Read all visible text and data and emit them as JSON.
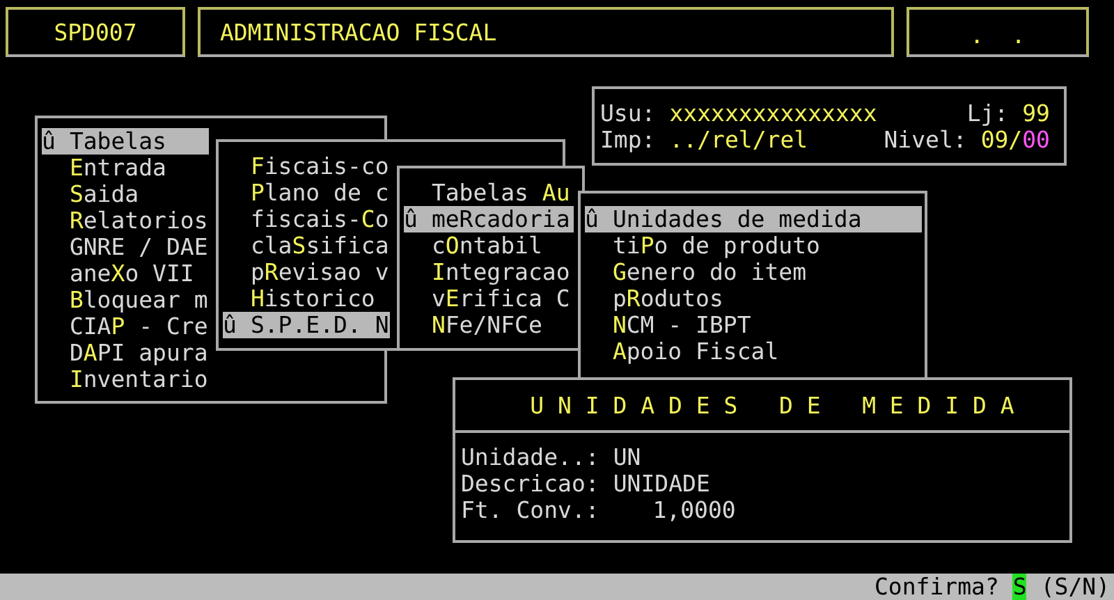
{
  "header": {
    "program_code": "SPD007",
    "title": "ADMINISTRACAO FISCAL",
    "right_text": ".  ."
  },
  "info": {
    "rows": [
      {
        "fields": [
          {
            "label": "Usu:",
            "value": "xxxxxxxxxxxxxxx"
          },
          {
            "label": "Lj:",
            "value": "99"
          }
        ]
      },
      {
        "fields": [
          {
            "label": "Imp:",
            "value": "../rel/rel"
          },
          {
            "label": "Nivel:",
            "value": "09/",
            "suffix": "00"
          }
        ]
      }
    ]
  },
  "menus": [
    {
      "items": [
        {
          "marker": "û",
          "before": "Tabelas",
          "selected": true
        },
        {
          "key": "E",
          "after": "ntrada",
          "selected": false
        },
        {
          "key": "S",
          "after": "aida",
          "selected": false
        },
        {
          "key": "R",
          "after": "elatorios",
          "selected": false
        },
        {
          "before": "GNRE / DAE",
          "selected": false
        },
        {
          "before": "ane",
          "key": "X",
          "after": "o VII",
          "selected": false
        },
        {
          "key": "B",
          "after": "loquear m",
          "selected": false
        },
        {
          "before": "CIA",
          "key": "P",
          "after": " - Cre",
          "selected": false
        },
        {
          "before": "D",
          "key": "A",
          "after": "PI apura",
          "selected": false
        },
        {
          "key": "I",
          "after": "nventario",
          "selected": false
        }
      ]
    },
    {
      "items": [
        {
          "key": "F",
          "after": "iscais-co",
          "selected": false
        },
        {
          "key": "P",
          "after": "lano de c",
          "selected": false
        },
        {
          "before": "fiscais-",
          "key": "C",
          "after": "o",
          "selected": false
        },
        {
          "before": "cla",
          "key": "S",
          "after": "sifica",
          "selected": false
        },
        {
          "before": "p",
          "key": "R",
          "after": "evisao v",
          "selected": false
        },
        {
          "key": "H",
          "after": "istorico",
          "selected": false
        },
        {
          "marker": "û",
          "before": "S.P.E.D. N",
          "selected": true
        }
      ]
    },
    {
      "items": [
        {
          "before": "Tabelas ",
          "key": "Au",
          "selected": false
        },
        {
          "marker": "û",
          "before": "meRcadoria",
          "selected": true
        },
        {
          "before": "c",
          "key": "O",
          "after": "ntabil",
          "selected": false
        },
        {
          "key": "I",
          "after": "ntegracao",
          "selected": false
        },
        {
          "before": "v",
          "key": "E",
          "after": "rifica C",
          "selected": false
        },
        {
          "key": "N",
          "after": "Fe/NFCe",
          "selected": false
        }
      ]
    },
    {
      "items": [
        {
          "marker": "û",
          "before": "Unidades de medida",
          "selected": true
        },
        {
          "before": "ti",
          "key": "P",
          "after": "o de produto",
          "selected": false
        },
        {
          "key": "G",
          "after": "enero do item",
          "selected": false
        },
        {
          "before": "p",
          "key": "R",
          "after": "odutos",
          "selected": false
        },
        {
          "key": "N",
          "after": "CM - IBPT",
          "selected": false
        },
        {
          "key": "A",
          "after": "poio Fiscal",
          "selected": false
        }
      ]
    }
  ],
  "detail": {
    "title": "U N I D A D E S   D E   M E D I D A",
    "fields": [
      {
        "label": "Unidade..:",
        "value": "UN",
        "kind": "text"
      },
      {
        "label": "Descricao:",
        "value": "UNIDADE",
        "kind": "text"
      },
      {
        "label": "Ft. Conv.:",
        "value": "1,0000",
        "kind": "number"
      }
    ]
  },
  "status_bar": {
    "prompt": "Confirma?",
    "answer": "S",
    "options": "(S/N)"
  }
}
